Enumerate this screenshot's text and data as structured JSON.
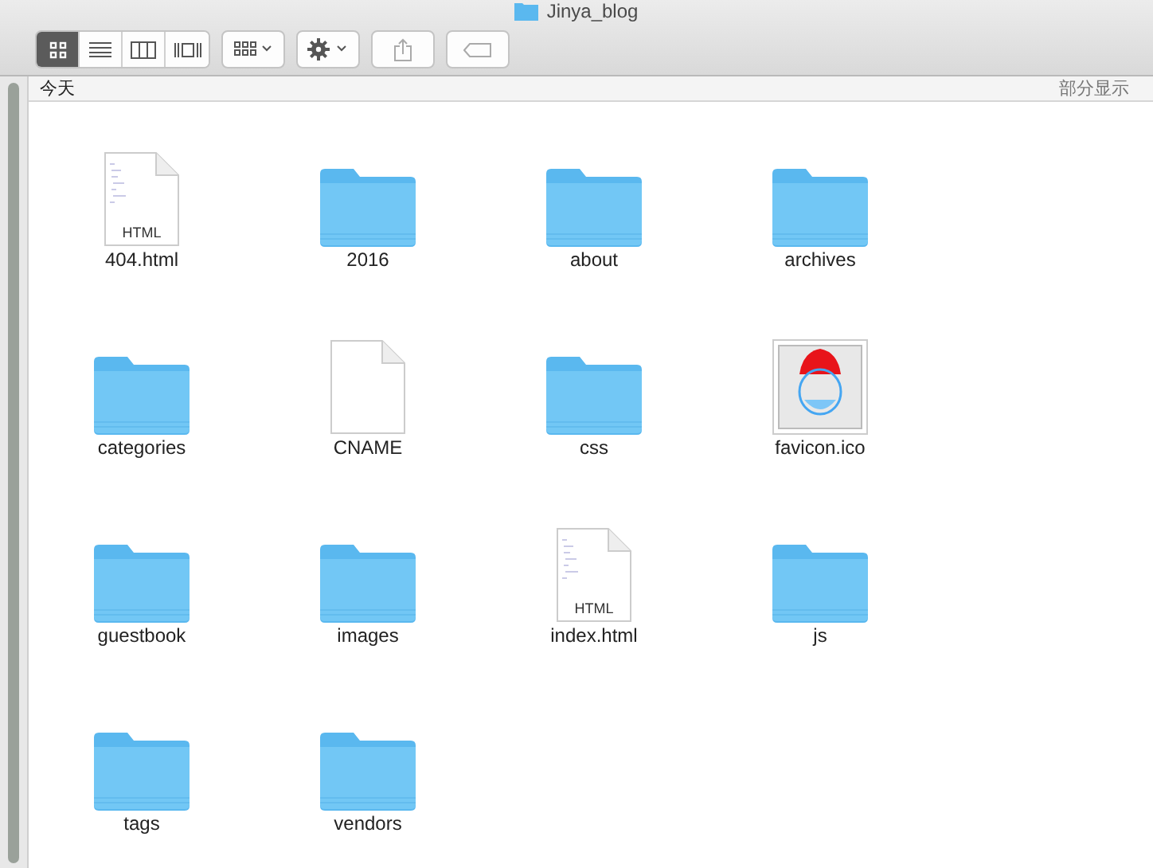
{
  "window": {
    "title": "Jinya_blog"
  },
  "toolbar": {
    "view_modes": [
      {
        "kind": "icons",
        "selected": true
      },
      {
        "kind": "list",
        "selected": false
      },
      {
        "kind": "columns",
        "selected": false
      },
      {
        "kind": "gallery",
        "selected": false
      }
    ]
  },
  "section": {
    "title": "今天",
    "action": "部分显示"
  },
  "files": [
    {
      "name": "404.html",
      "kind": "html",
      "badge": "HTML"
    },
    {
      "name": "2016",
      "kind": "folder"
    },
    {
      "name": "about",
      "kind": "folder"
    },
    {
      "name": "archives",
      "kind": "folder"
    },
    {
      "name": "categories",
      "kind": "folder"
    },
    {
      "name": "CNAME",
      "kind": "document"
    },
    {
      "name": "css",
      "kind": "folder"
    },
    {
      "name": "favicon.ico",
      "kind": "image"
    },
    {
      "name": "guestbook",
      "kind": "folder"
    },
    {
      "name": "images",
      "kind": "folder"
    },
    {
      "name": "index.html",
      "kind": "html",
      "badge": "HTML"
    },
    {
      "name": "js",
      "kind": "folder"
    },
    {
      "name": "tags",
      "kind": "folder"
    },
    {
      "name": "vendors",
      "kind": "folder"
    }
  ]
}
